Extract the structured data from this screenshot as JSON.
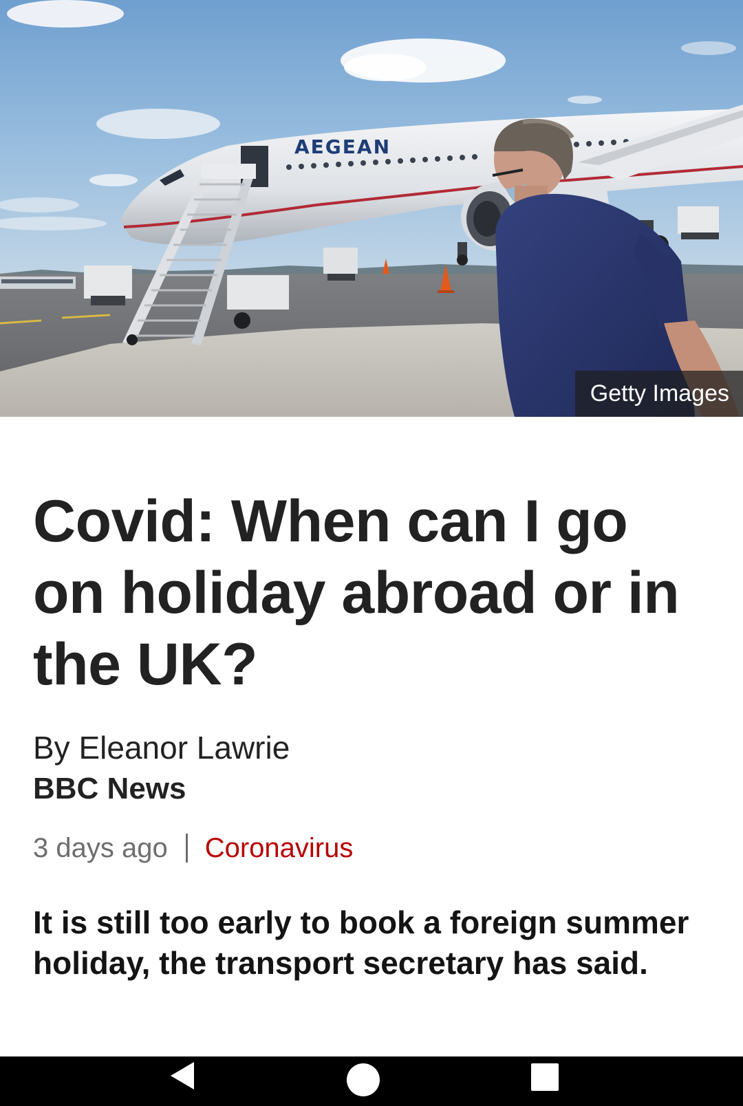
{
  "hero": {
    "image_description_icon": "photo-airplane-icon",
    "credit": "Getty Images"
  },
  "article": {
    "headline": "Covid: When can I go on holiday abroad or in the UK?",
    "byline": "By Eleanor Lawrie",
    "organisation": "BBC News",
    "timestamp": "3 days ago",
    "topic": "Coronavirus",
    "intro": "It is still too early to book a foreign summer holiday, the transport secretary has said."
  },
  "colors": {
    "topic": "#b80000",
    "text": "#222222",
    "muted": "#6e6e6e",
    "navbar": "#000000"
  },
  "navbar": {
    "back_icon": "back-triangle-icon",
    "home_icon": "home-circle-icon",
    "recents_icon": "recents-square-icon"
  }
}
